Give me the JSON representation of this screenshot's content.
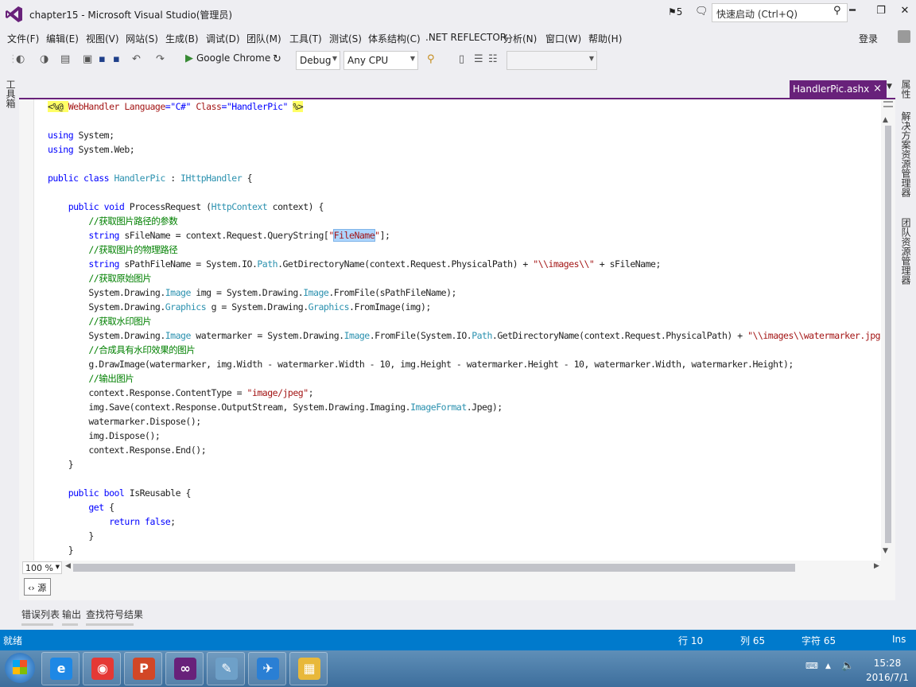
{
  "titlebar": {
    "title": "chapter15 - Microsoft Visual Studio(管理员)",
    "notifications": "5",
    "quick_launch_placeholder": "快速启动 (Ctrl+Q)",
    "minimize": "━",
    "restore": "❐",
    "close": "✕"
  },
  "menu": [
    "文件(F)",
    "编辑(E)",
    "视图(V)",
    "网站(S)",
    "生成(B)",
    "调试(D)",
    "团队(M)",
    "工具(T)",
    "测试(S)",
    "体系结构(C)",
    ".NET REFLECTOR",
    "分析(N)",
    "窗口(W)",
    "帮助(H)"
  ],
  "account": {
    "login": "登录"
  },
  "toolbar": {
    "run_target": "Google Chrome",
    "configuration": "Debug",
    "platform": "Any CPU"
  },
  "left_tabs": {
    "toolbox": "工具箱"
  },
  "right_tabs": [
    "属性",
    "解决方案资源管理器",
    "团队资源管理器"
  ],
  "document_tab": {
    "name": "HandlerPic.ashx",
    "close": "×"
  },
  "editor": {
    "zoom": "100 %",
    "source_button": "‹› 源"
  },
  "code_lines": [
    [
      {
        "t": "<%@ ",
        "c": "hl"
      },
      {
        "t": "WebHandler ",
        "c": "st"
      },
      {
        "t": "Language",
        "c": "st"
      },
      {
        "t": "=\"C#\" ",
        "c": "kw"
      },
      {
        "t": "Class",
        "c": "st"
      },
      {
        "t": "=\"HandlerPic\" ",
        "c": "kw"
      },
      {
        "t": "%>",
        "c": "hl"
      }
    ],
    [],
    [
      {
        "t": "using ",
        "c": "kw"
      },
      {
        "t": "System;",
        "c": ""
      }
    ],
    [
      {
        "t": "using ",
        "c": "kw"
      },
      {
        "t": "System.Web;",
        "c": ""
      }
    ],
    [],
    [
      {
        "t": "public class ",
        "c": "kw"
      },
      {
        "t": "HandlerPic",
        "c": "ty"
      },
      {
        "t": " : ",
        "c": ""
      },
      {
        "t": "IHttpHandler",
        "c": "ty"
      },
      {
        "t": " {",
        "c": ""
      }
    ],
    [],
    [
      {
        "t": "    public void ",
        "c": "kw"
      },
      {
        "t": "ProcessRequest (",
        "c": ""
      },
      {
        "t": "HttpContext",
        "c": "ty"
      },
      {
        "t": " context) {",
        "c": ""
      }
    ],
    [
      {
        "t": "        //获取图片路径的参数",
        "c": "cm"
      }
    ],
    [
      {
        "t": "        string ",
        "c": "kw"
      },
      {
        "t": "sFileName = context.Request.QueryString[",
        "c": ""
      },
      {
        "t": "\"",
        "c": "st"
      },
      {
        "t": "FileName",
        "c": "st sel"
      },
      {
        "t": "\"",
        "c": "st"
      },
      {
        "t": "];",
        "c": ""
      }
    ],
    [
      {
        "t": "        //获取图片的物理路径",
        "c": "cm"
      }
    ],
    [
      {
        "t": "        string ",
        "c": "kw"
      },
      {
        "t": "sPathFileName = System.IO.",
        "c": ""
      },
      {
        "t": "Path",
        "c": "ty"
      },
      {
        "t": ".GetDirectoryName(context.Request.PhysicalPath) + ",
        "c": ""
      },
      {
        "t": "\"\\\\images\\\\\"",
        "c": "st"
      },
      {
        "t": " + sFileName;",
        "c": ""
      }
    ],
    [
      {
        "t": "        //获取原始图片",
        "c": "cm"
      }
    ],
    [
      {
        "t": "        System.Drawing.",
        "c": ""
      },
      {
        "t": "Image",
        "c": "ty"
      },
      {
        "t": " img = System.Drawing.",
        "c": ""
      },
      {
        "t": "Image",
        "c": "ty"
      },
      {
        "t": ".FromFile(sPathFileName);",
        "c": ""
      }
    ],
    [
      {
        "t": "        System.Drawing.",
        "c": ""
      },
      {
        "t": "Graphics",
        "c": "ty"
      },
      {
        "t": " g = System.Drawing.",
        "c": ""
      },
      {
        "t": "Graphics",
        "c": "ty"
      },
      {
        "t": ".FromImage(img);",
        "c": ""
      }
    ],
    [
      {
        "t": "        //获取水印图片",
        "c": "cm"
      }
    ],
    [
      {
        "t": "        System.Drawing.",
        "c": ""
      },
      {
        "t": "Image",
        "c": "ty"
      },
      {
        "t": " watermarker = System.Drawing.",
        "c": ""
      },
      {
        "t": "Image",
        "c": "ty"
      },
      {
        "t": ".FromFile(System.IO.",
        "c": ""
      },
      {
        "t": "Path",
        "c": "ty"
      },
      {
        "t": ".GetDirectoryName(context.Request.PhysicalPath) + ",
        "c": ""
      },
      {
        "t": "\"\\\\images\\\\watermarker.jpg\"",
        "c": "st"
      },
      {
        "t": ");",
        "c": ""
      }
    ],
    [
      {
        "t": "        //合成具有水印效果的图片",
        "c": "cm"
      }
    ],
    [
      {
        "t": "        g.DrawImage(watermarker, img.Width - watermarker.Width - 10, img.Height - watermarker.Height - 10, watermarker.Width, watermarker.Height);",
        "c": ""
      }
    ],
    [
      {
        "t": "        //输出图片",
        "c": "cm"
      }
    ],
    [
      {
        "t": "        context.Response.ContentType = ",
        "c": ""
      },
      {
        "t": "\"image/jpeg\"",
        "c": "st"
      },
      {
        "t": ";",
        "c": ""
      }
    ],
    [
      {
        "t": "        img.Save(context.Response.OutputStream, System.Drawing.Imaging.",
        "c": ""
      },
      {
        "t": "ImageFormat",
        "c": "ty"
      },
      {
        "t": ".Jpeg);",
        "c": ""
      }
    ],
    [
      {
        "t": "        watermarker.Dispose();",
        "c": ""
      }
    ],
    [
      {
        "t": "        img.Dispose();",
        "c": ""
      }
    ],
    [
      {
        "t": "        context.Response.End();",
        "c": ""
      }
    ],
    [
      {
        "t": "    }",
        "c": ""
      }
    ],
    [],
    [
      {
        "t": "    public bool ",
        "c": "kw"
      },
      {
        "t": "IsReusable {",
        "c": ""
      }
    ],
    [
      {
        "t": "        get ",
        "c": "kw"
      },
      {
        "t": "{",
        "c": ""
      }
    ],
    [
      {
        "t": "            return false",
        "c": "kw"
      },
      {
        "t": ";",
        "c": ""
      }
    ],
    [
      {
        "t": "        }",
        "c": ""
      }
    ],
    [
      {
        "t": "    }",
        "c": ""
      }
    ]
  ],
  "bottom_tabs": [
    "错误列表",
    "输出",
    "查找符号结果"
  ],
  "status": {
    "ready": "就绪",
    "line": "行 10",
    "col": "列 65",
    "char": "字符 65",
    "mode": "Ins"
  },
  "taskbar": {
    "apps": [
      {
        "name": "internet-explorer",
        "glyph": "e",
        "color": "#1e88e5"
      },
      {
        "name": "chrome",
        "glyph": "◉",
        "color": "#e53935"
      },
      {
        "name": "powerpoint",
        "glyph": "P",
        "color": "#d24726"
      },
      {
        "name": "visual-studio",
        "glyph": "∞",
        "color": "#68217a"
      },
      {
        "name": "notepad",
        "glyph": "✎",
        "color": "#6ea0c8"
      },
      {
        "name": "feather-app",
        "glyph": "✈",
        "color": "#2a7fd4"
      },
      {
        "name": "file-explorer",
        "glyph": "▦",
        "color": "#e8b83a"
      }
    ],
    "time": "15:28",
    "date": "2016/7/1"
  }
}
